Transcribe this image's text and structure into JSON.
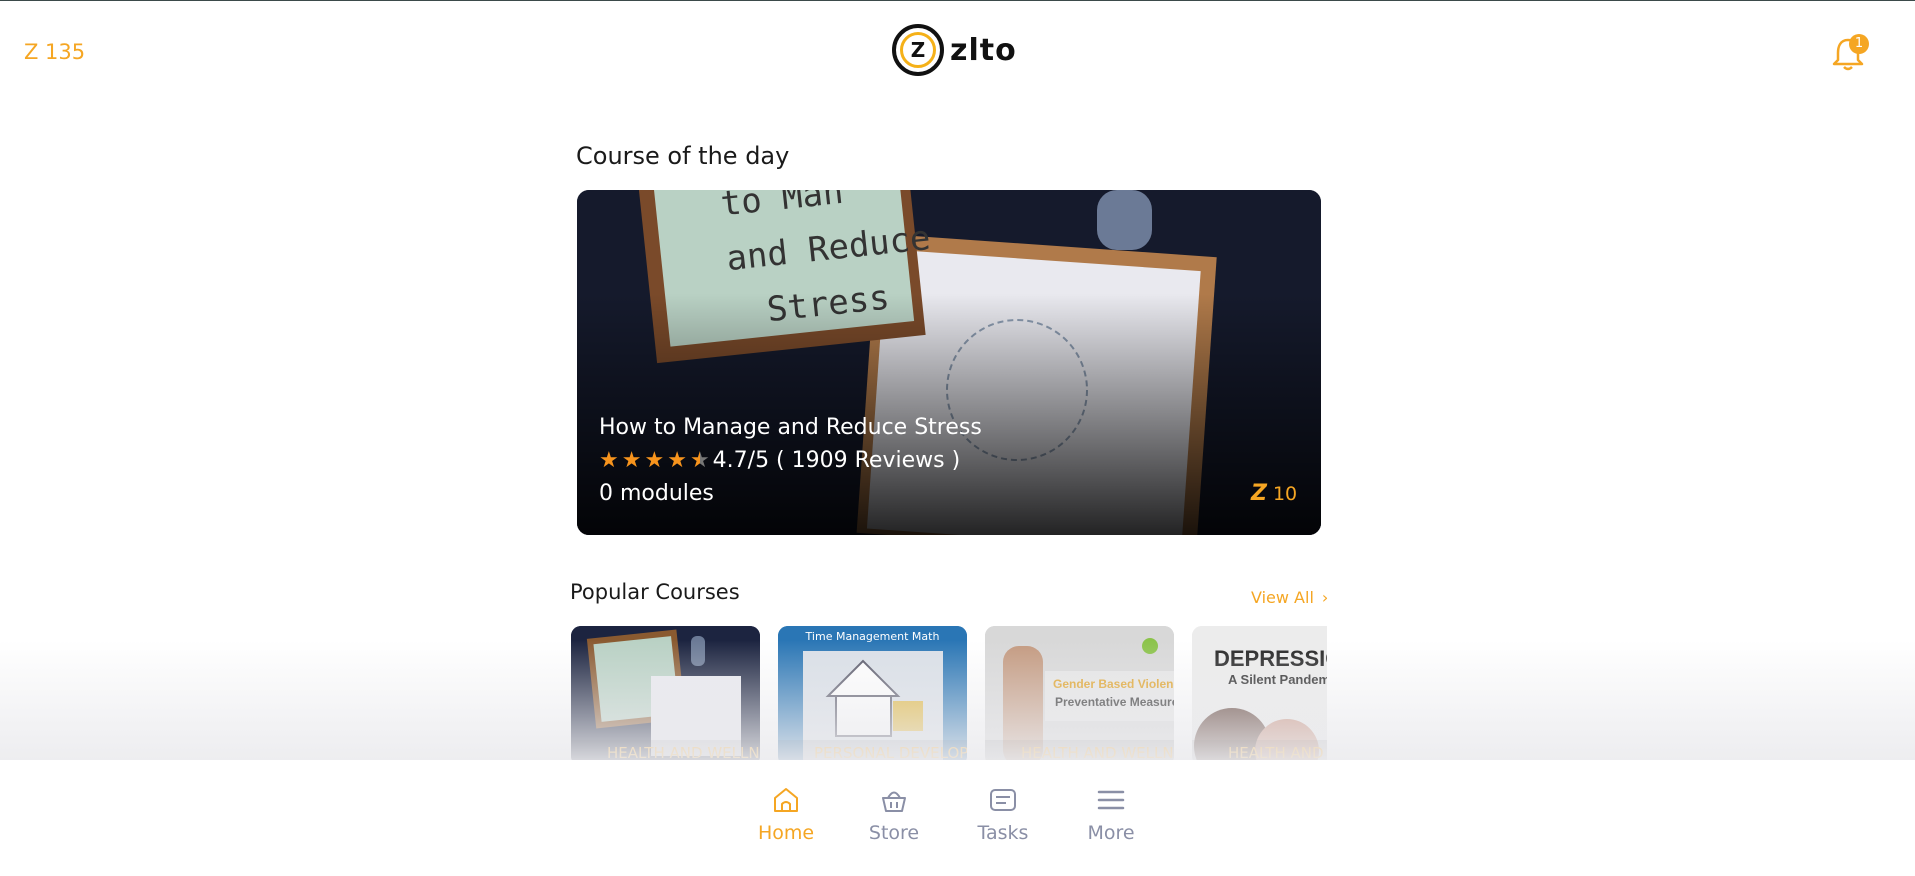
{
  "header": {
    "balance": "Z 135",
    "logo_mark": "Z",
    "logo_text": "zlto",
    "notification_count": "1",
    "bell_icon": "bell-icon"
  },
  "course_of_day": {
    "section_title": "Course of the day",
    "course_title": "How to Manage and Reduce Stress",
    "rating_stars": 4.5,
    "rating_text": "4.7/5 ( 1909 Reviews )",
    "modules": "0 modules",
    "reward_icon": "Z",
    "reward": "10"
  },
  "popular": {
    "title": "Popular Courses",
    "view_all": "View All",
    "cards": [
      {
        "category": "HEALTH AND WELLNESS",
        "top_text": ""
      },
      {
        "category": "PERSONAL DEVELOPMENT",
        "top_text": "Time Management Math"
      },
      {
        "category": "HEALTH AND WELLNESS",
        "top_text": ""
      },
      {
        "category": "HEALTH AND WELLNESS",
        "top_text": ""
      }
    ]
  },
  "nav": {
    "items": [
      {
        "label": "Home",
        "icon": "home-icon",
        "active": true
      },
      {
        "label": "Store",
        "icon": "basket-icon",
        "active": false
      },
      {
        "label": "Tasks",
        "icon": "tasks-icon",
        "active": false
      },
      {
        "label": "More",
        "icon": "menu-icon",
        "active": false
      }
    ]
  },
  "colors": {
    "accent": "#f5a623",
    "nav_inactive": "#8a8fa6"
  }
}
